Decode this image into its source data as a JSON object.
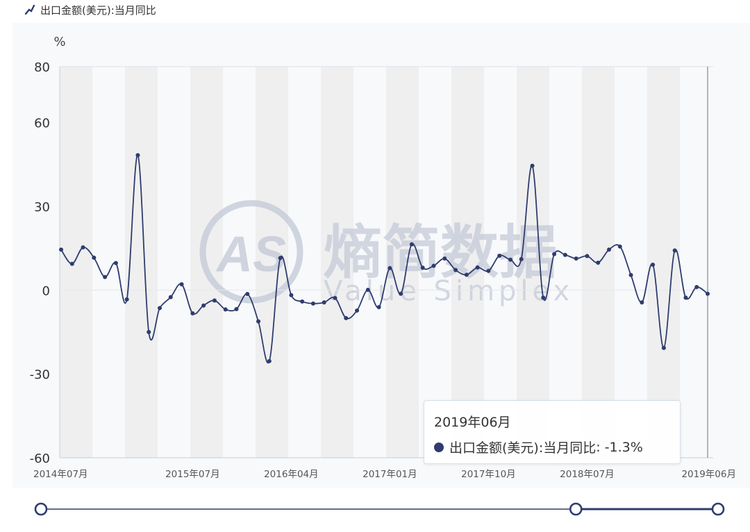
{
  "header": {
    "title": "出口金额(美元):当月同比"
  },
  "colors": {
    "series": "#2e3c6e",
    "band": "#efefef",
    "slider": "#2e3c6e",
    "watermark": "#c2c8d6"
  },
  "watermark": {
    "cn": "熵简数据",
    "en": "Value Simplex",
    "logo": "AS"
  },
  "chart_data": {
    "type": "line",
    "title": "出口金额(美元):当月同比",
    "unit": "%",
    "ylim": [
      -60,
      80
    ],
    "yticks": [
      80,
      60,
      30,
      0,
      -30,
      -60
    ],
    "xtick_labels": [
      "2014年07月",
      "2015年07月",
      "2016年04月",
      "2017年01月",
      "2017年10月",
      "2018年07月",
      "2019年06月"
    ],
    "xtick_indices": [
      0,
      12,
      21,
      30,
      39,
      48,
      59
    ],
    "x": [
      "2014-07",
      "2014-08",
      "2014-09",
      "2014-10",
      "2014-11",
      "2014-12",
      "2015-01",
      "2015-02",
      "2015-03",
      "2015-04",
      "2015-05",
      "2015-06",
      "2015-07",
      "2015-08",
      "2015-09",
      "2015-10",
      "2015-11",
      "2015-12",
      "2016-01",
      "2016-02",
      "2016-03",
      "2016-04",
      "2016-05",
      "2016-06",
      "2016-07",
      "2016-08",
      "2016-09",
      "2016-10",
      "2016-11",
      "2016-12",
      "2017-01",
      "2017-02",
      "2017-03",
      "2017-04",
      "2017-05",
      "2017-06",
      "2017-07",
      "2017-08",
      "2017-09",
      "2017-10",
      "2017-11",
      "2017-12",
      "2018-01",
      "2018-02",
      "2018-03",
      "2018-04",
      "2018-05",
      "2018-06",
      "2018-07",
      "2018-08",
      "2018-09",
      "2018-10",
      "2018-11",
      "2018-12",
      "2019-01",
      "2019-02",
      "2019-03",
      "2019-04",
      "2019-05",
      "2019-06"
    ],
    "series": [
      {
        "values": [
          14.5,
          9.4,
          15.3,
          11.6,
          4.7,
          9.7,
          -3.3,
          48.3,
          -15.0,
          -6.4,
          -2.5,
          2.1,
          -8.3,
          -5.5,
          -3.7,
          -6.9,
          -6.8,
          -1.4,
          -11.2,
          -25.4,
          11.5,
          -1.8,
          -4.1,
          -4.8,
          -4.4,
          -2.8,
          -10.0,
          -7.3,
          0.1,
          -6.1,
          7.9,
          -1.3,
          16.4,
          8.0,
          8.7,
          11.3,
          7.2,
          5.5,
          8.1,
          6.9,
          12.3,
          10.9,
          11.1,
          44.5,
          -2.7,
          12.9,
          12.6,
          11.3,
          12.2,
          9.8,
          14.5,
          15.6,
          5.4,
          -4.4,
          9.1,
          -20.7,
          14.2,
          -2.7,
          1.1,
          -1.3
        ]
      }
    ],
    "grid": false,
    "alternating_bands": true,
    "tooltip": {
      "date": "2019年06月",
      "label": "出口金额(美元):当月同比",
      "value_text": "-1.3%"
    },
    "range_slider": {
      "start_fraction": 0.0,
      "end_fraction": 1.0,
      "handle_fraction": 0.79
    }
  }
}
